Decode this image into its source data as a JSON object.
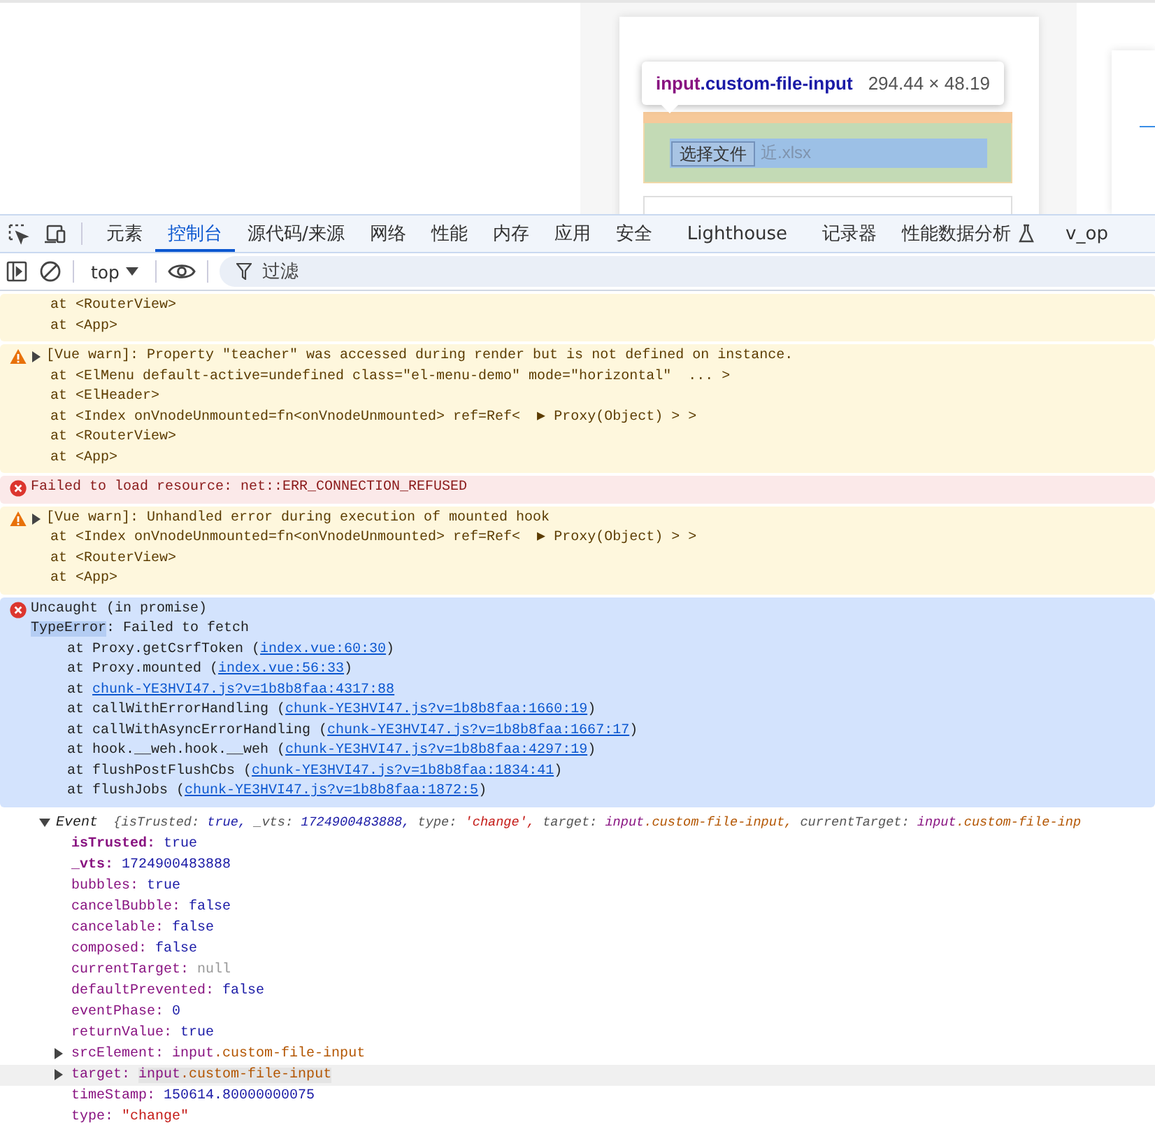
{
  "page": {
    "file_button": "选择文件",
    "file_name": "近.xlsx"
  },
  "tooltip": {
    "tag": "input",
    "class": ".custom-file-input",
    "size": "294.44 × 48.19"
  },
  "devtools": {
    "tabs": [
      {
        "label": "元素",
        "selected": false
      },
      {
        "label": "控制台",
        "selected": true
      },
      {
        "label": "源代码/来源",
        "selected": false
      },
      {
        "label": "网络",
        "selected": false
      },
      {
        "label": "性能",
        "selected": false
      },
      {
        "label": "内存",
        "selected": false
      },
      {
        "label": "应用",
        "selected": false
      },
      {
        "label": "安全",
        "selected": false
      },
      {
        "label": "Lighthouse",
        "selected": false
      },
      {
        "label": "记录器",
        "selected": false
      },
      {
        "label": "性能数据分析",
        "selected": false,
        "kind": "experiment"
      },
      {
        "label": "v_op",
        "selected": false
      }
    ],
    "context": "top",
    "filter": {
      "placeholder": "过滤"
    }
  },
  "console": {
    "messages": [
      {
        "kind": "warn",
        "selected": false,
        "expandable": false,
        "lines": [
          {
            "kind": "at",
            "text": "at <RouterView>"
          },
          {
            "kind": "at",
            "text": "at <App>"
          }
        ]
      },
      {
        "kind": "warn",
        "selected": false,
        "expandable": true,
        "text": "[Vue warn]: Property \"teacher\" was accessed during render but is not defined on instance.",
        "lines": [
          {
            "kind": "at",
            "text": "at <ElMenu default-active=undefined class=\"el-menu-demo\" mode=\"horizontal\"  ... >"
          },
          {
            "kind": "at",
            "text": "at <ElHeader>"
          },
          {
            "kind": "at",
            "text": "at <Index onVnodeUnmounted=fn<onVnodeUnmounted> ref=Ref<  ▶ Proxy(Object) > >"
          },
          {
            "kind": "at",
            "text": "at <RouterView>"
          },
          {
            "kind": "at",
            "text": "at <App>"
          }
        ]
      },
      {
        "kind": "error",
        "selected": false,
        "expandable": false,
        "text": "Failed to load resource: net::ERR_CONNECTION_REFUSED"
      },
      {
        "kind": "warn",
        "selected": false,
        "expandable": true,
        "text": "[Vue warn]: Unhandled error during execution of mounted hook",
        "lines": [
          {
            "kind": "at",
            "text": "at <Index onVnodeUnmounted=fn<onVnodeUnmounted> ref=Ref<  ▶ Proxy(Object) > >"
          },
          {
            "kind": "at",
            "text": "at <RouterView>"
          },
          {
            "kind": "at",
            "text": "at <App>"
          }
        ]
      },
      {
        "kind": "error",
        "selected": true,
        "expandable": false,
        "text": "Uncaught (in promise)",
        "lines": [
          {
            "kind": "plain",
            "mark": "TypeError",
            "text": ": Failed to fetch"
          },
          {
            "kind": "frame",
            "text": "at Proxy.getCsrfToken (",
            "link": "index.vue:60:30",
            "tail": ")"
          },
          {
            "kind": "frame",
            "text": "at Proxy.mounted (",
            "link": "index.vue:56:33",
            "tail": ")"
          },
          {
            "kind": "frame",
            "text": "at ",
            "link": "chunk-YE3HVI47.js?v=1b8b8faa:4317:88"
          },
          {
            "kind": "frame",
            "text": "at callWithErrorHandling (",
            "link": "chunk-YE3HVI47.js?v=1b8b8faa:1660:19",
            "tail": ")"
          },
          {
            "kind": "frame",
            "text": "at callWithAsyncErrorHandling (",
            "link": "chunk-YE3HVI47.js?v=1b8b8faa:1667:17",
            "tail": ")"
          },
          {
            "kind": "frame",
            "text": "at hook.__weh.hook.__weh (",
            "link": "chunk-YE3HVI47.js?v=1b8b8faa:4297:19",
            "tail": ")"
          },
          {
            "kind": "frame",
            "text": "at flushPostFlushCbs (",
            "link": "chunk-YE3HVI47.js?v=1b8b8faa:1834:41",
            "tail": ")"
          },
          {
            "kind": "frame",
            "text": "at flushJobs (",
            "link": "chunk-YE3HVI47.js?v=1b8b8faa:1872:5",
            "tail": ")"
          }
        ]
      }
    ],
    "object": {
      "name": "Event",
      "expanded": true,
      "open": "{",
      "preview": [
        {
          "key": "isTrusted:",
          "kind": "bool",
          "value": "true,"
        },
        {
          "key": "_vts:",
          "kind": "number",
          "value": "1724900483888,"
        },
        {
          "key": "type:",
          "kind": "string",
          "value": "'change',"
        },
        {
          "key": "target:",
          "kind": "node",
          "value": "input",
          "value_class": ".custom-file-input,"
        },
        {
          "key": "currentTarget:",
          "kind": "node",
          "value": "input",
          "value_class": ".custom-file-inp"
        }
      ],
      "properties": [
        {
          "key": "isTrusted:",
          "own": true,
          "expandable": false,
          "hovered": false,
          "kind": "bool",
          "value": "true"
        },
        {
          "key": "_vts:",
          "own": true,
          "expandable": false,
          "hovered": false,
          "kind": "number",
          "value": "1724900483888"
        },
        {
          "key": "bubbles:",
          "own": false,
          "expandable": false,
          "hovered": false,
          "kind": "bool",
          "value": "true"
        },
        {
          "key": "cancelBubble:",
          "own": false,
          "expandable": false,
          "hovered": false,
          "kind": "bool",
          "value": "false"
        },
        {
          "key": "cancelable:",
          "own": false,
          "expandable": false,
          "hovered": false,
          "kind": "bool",
          "value": "false"
        },
        {
          "key": "composed:",
          "own": false,
          "expandable": false,
          "hovered": false,
          "kind": "bool",
          "value": "false"
        },
        {
          "key": "currentTarget:",
          "own": false,
          "expandable": false,
          "hovered": false,
          "kind": "null",
          "value": "null"
        },
        {
          "key": "defaultPrevented:",
          "own": false,
          "expandable": false,
          "hovered": false,
          "kind": "bool",
          "value": "false"
        },
        {
          "key": "eventPhase:",
          "own": false,
          "expandable": false,
          "hovered": false,
          "kind": "number",
          "value": "0"
        },
        {
          "key": "returnValue:",
          "own": false,
          "expandable": false,
          "hovered": false,
          "kind": "bool",
          "value": "true"
        },
        {
          "key": "srcElement:",
          "own": false,
          "expandable": true,
          "hovered": false,
          "kind": "node",
          "value": "input",
          "value_class": ".custom-file-input"
        },
        {
          "key": "target:",
          "own": false,
          "expandable": true,
          "hovered": true,
          "kind": "node",
          "value": "input",
          "value_class": ".custom-file-input"
        },
        {
          "key": "timeStamp:",
          "own": false,
          "expandable": false,
          "hovered": false,
          "kind": "number",
          "value": "150614.80000000075"
        },
        {
          "key": "type:",
          "own": false,
          "expandable": false,
          "hovered": false,
          "kind": "string",
          "value": "\"change\""
        }
      ]
    }
  }
}
